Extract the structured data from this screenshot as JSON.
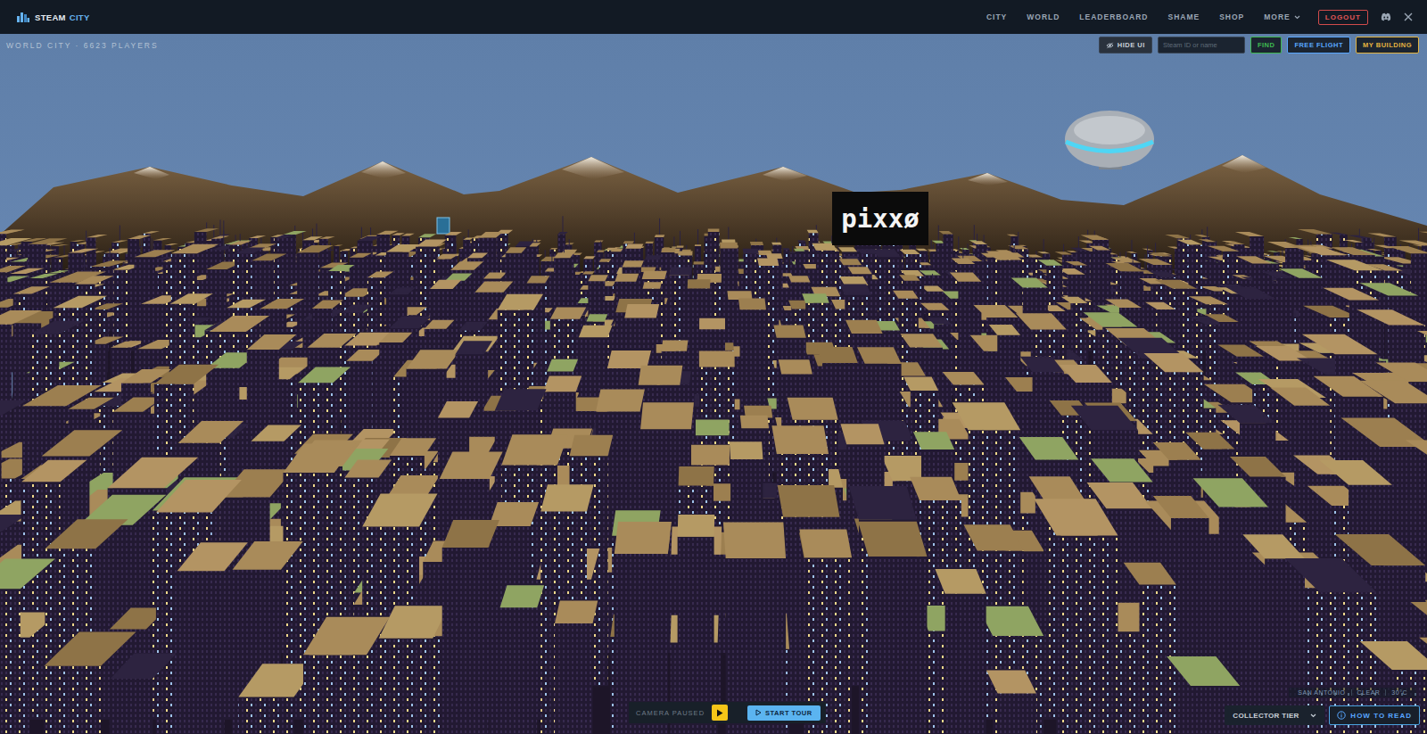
{
  "header": {
    "logo": {
      "first": "STEAM",
      "second": "CITY"
    },
    "nav": [
      "CITY",
      "WORLD",
      "LEADERBOARD",
      "SHAME",
      "SHOP"
    ],
    "more": "MORE",
    "logout": "LOGOUT"
  },
  "scene": {
    "title": "WORLD CITY · 6623 PLAYERS",
    "billboard": "pixxø"
  },
  "toolbar": {
    "hide_ui": "HIDE UI",
    "search": {
      "placeholder": "Steam ID or name"
    },
    "buttons": [
      {
        "label": "FIND",
        "color": "#3fb950"
      },
      {
        "label": "FREE FLIGHT",
        "color": "#58a6ff"
      },
      {
        "label": "MY BUILDING",
        "color": "#e3b341"
      }
    ]
  },
  "camera": {
    "status": "CAMERA PAUSED",
    "paused": true,
    "tour": "START TOUR"
  },
  "weather": [
    "SAN ANTONIO",
    "CLEAR",
    "30°C"
  ],
  "tier_select": {
    "value": "COLLECTOR TIER"
  },
  "how_to_read": "HOW TO READ"
}
